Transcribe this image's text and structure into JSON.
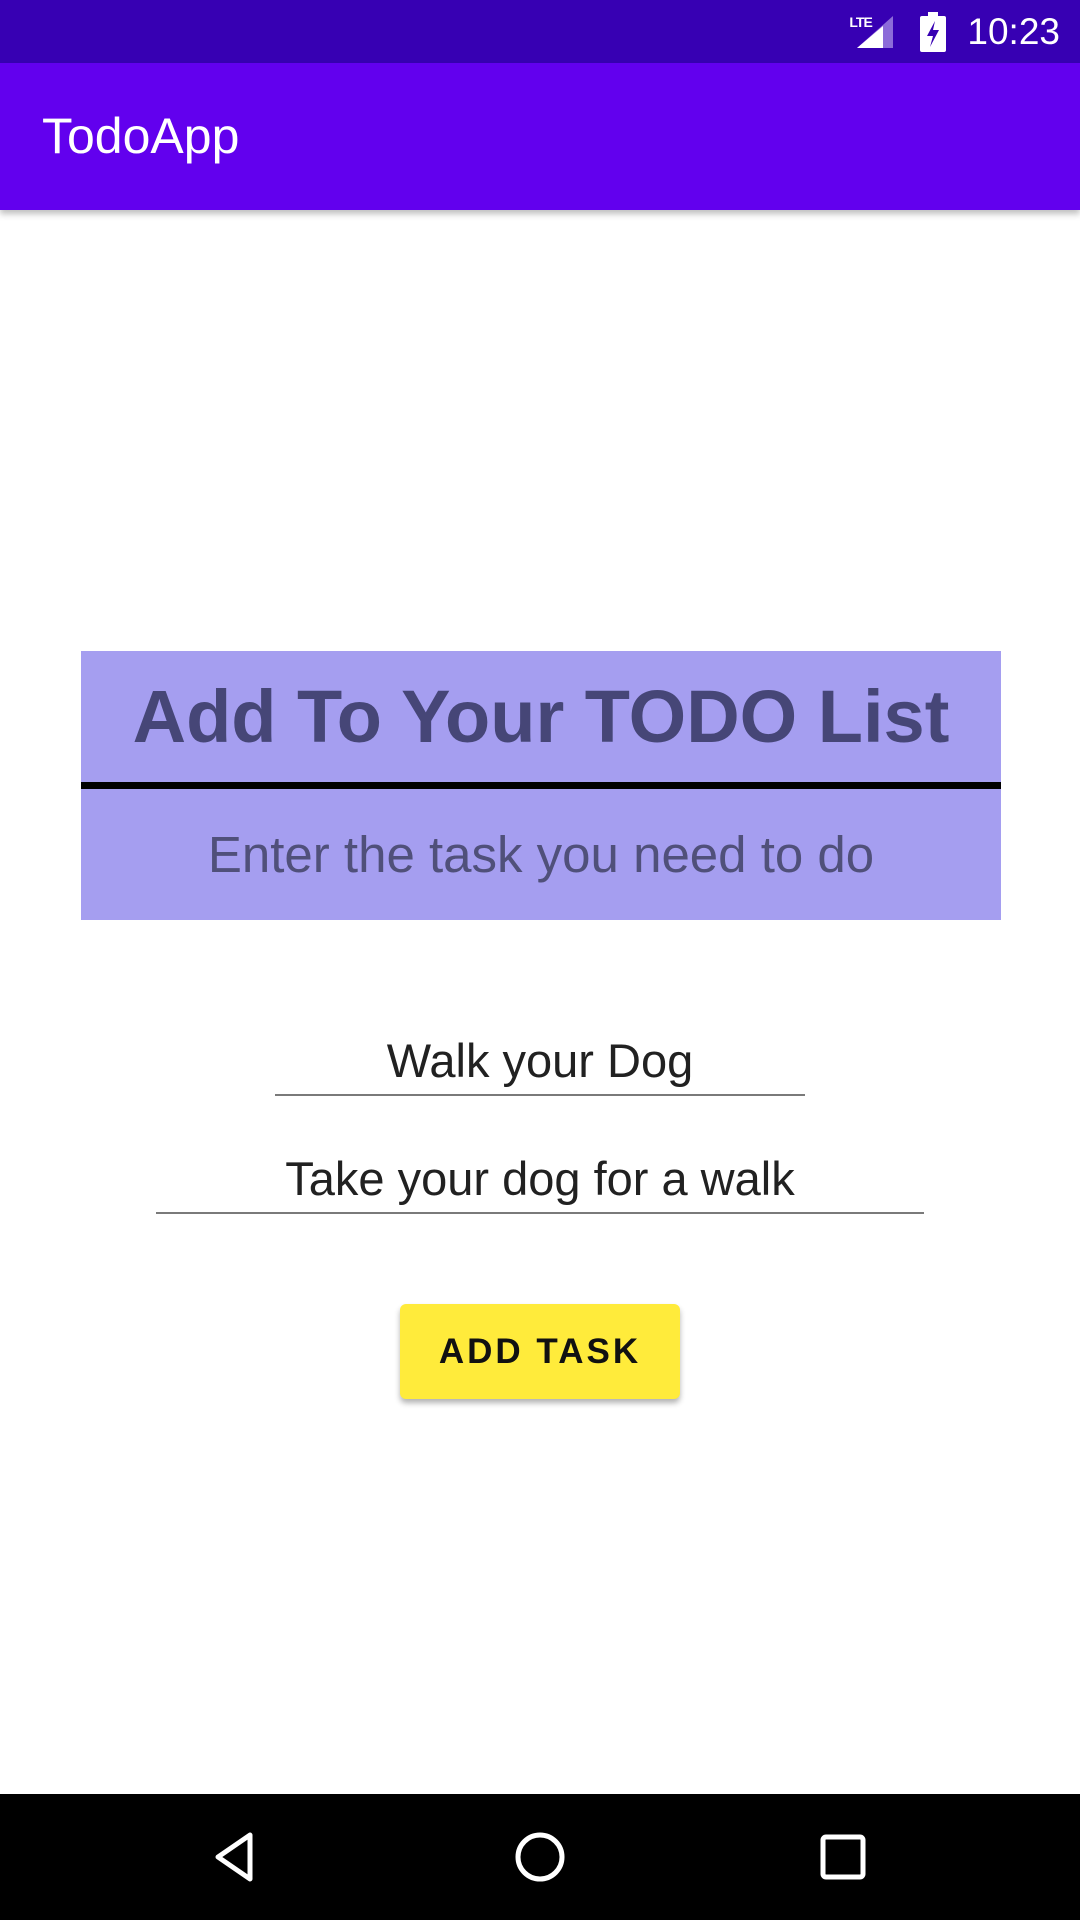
{
  "status_bar": {
    "network_label": "LTE",
    "time": "10:23"
  },
  "app_bar": {
    "title": "TodoApp"
  },
  "header": {
    "title": "Add To Your TODO List",
    "subtitle": "Enter the task you need to do"
  },
  "form": {
    "task_title_value": "Walk your Dog",
    "task_description_value": "Take your dog for a walk",
    "add_button_label": "ADD TASK"
  },
  "colors": {
    "status_bar": "#3700b3",
    "app_bar": "#6200ee",
    "header_panel": "#a59ef0",
    "header_text": "#464677",
    "button": "#ffeb3b"
  },
  "nav_bar": {
    "icons": [
      "back-icon",
      "home-icon",
      "recents-icon"
    ]
  }
}
